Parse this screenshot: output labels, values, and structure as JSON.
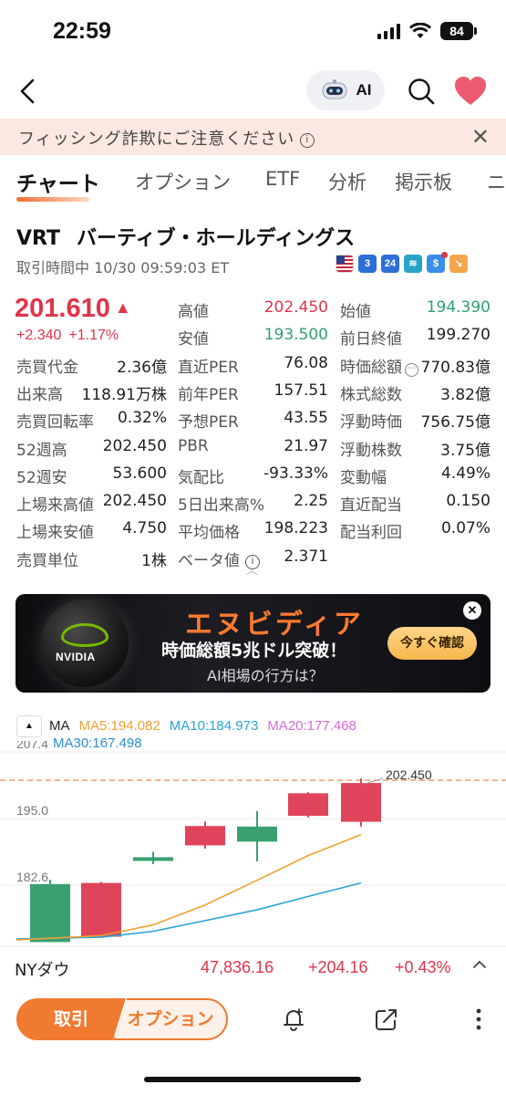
{
  "status": {
    "time": "22:59",
    "battery": "84"
  },
  "nav": {
    "ai_label": "AI"
  },
  "banner": {
    "text": "フィッシング詐欺にご注意ください"
  },
  "tabs": [
    "チャート",
    "オプション",
    "ETF",
    "分析",
    "掲示板",
    "ニ"
  ],
  "stock": {
    "ticker": "VRT",
    "name": "バーティブ・ホールディングス",
    "trade_status": "取引時間中 10/30 09:59:03 ET",
    "price": "201.610",
    "change": "+2.340",
    "change_pct": "+1.17%"
  },
  "badges": [
    {
      "icon": "us-flag-icon",
      "text": "",
      "color": "#ffffff"
    },
    {
      "icon": "level-3-icon",
      "text": "3",
      "color": "#2d6fd8"
    },
    {
      "icon": "24h-icon",
      "text": "24",
      "color": "#2d6fd8"
    },
    {
      "icon": "chart-line-icon",
      "text": "",
      "color": "#2aa3c9"
    },
    {
      "icon": "dollar-icon",
      "text": "$",
      "color": "#3b8ee8"
    },
    {
      "icon": "trend-icon",
      "text": "",
      "color": "#f3a74a"
    }
  ],
  "quote": {
    "col1": [
      {
        "label": "売買代金",
        "value": "2.36億"
      },
      {
        "label": "出来高",
        "value": "118.91万株"
      },
      {
        "label": "売買回転率",
        "value": "0.32%"
      },
      {
        "label": "52週高",
        "value": "202.450"
      },
      {
        "label": "52週安",
        "value": "53.600"
      },
      {
        "label": "上場来高値",
        "value": "202.450"
      },
      {
        "label": "上場来安値",
        "value": "4.750"
      },
      {
        "label": "売買単位",
        "value": "1株"
      }
    ],
    "col2": [
      {
        "label": "高値",
        "value": "202.450",
        "tone": "red"
      },
      {
        "label": "安値",
        "value": "193.500",
        "tone": "green"
      },
      {
        "label": "直近PER",
        "value": "76.08"
      },
      {
        "label": "前年PER",
        "value": "157.51"
      },
      {
        "label": "予想PER",
        "value": "43.55"
      },
      {
        "label": "PBR",
        "value": "21.97"
      },
      {
        "label": "気配比",
        "value": "-93.33%"
      },
      {
        "label": "5日出来高%",
        "value": "2.25"
      },
      {
        "label": "平均価格",
        "value": "198.223"
      },
      {
        "label": "ベータ値",
        "value": "2.371"
      }
    ],
    "col3": [
      {
        "label": "始値",
        "value": "194.390",
        "tone": "green"
      },
      {
        "label": "前日終値",
        "value": "199.270"
      },
      {
        "label": "時価総額",
        "value": "770.83億"
      },
      {
        "label": "株式総数",
        "value": "3.82億"
      },
      {
        "label": "浮動時価",
        "value": "756.75億"
      },
      {
        "label": "浮動株数",
        "value": "3.75億"
      },
      {
        "label": "変動幅",
        "value": "4.49%"
      },
      {
        "label": "直近配当",
        "value": "0.150"
      },
      {
        "label": "配当利回",
        "value": "0.07%"
      }
    ]
  },
  "ad": {
    "brand": "NVIDIA",
    "title": "エヌビディア",
    "line1": "時価総額5兆ドル突破！",
    "line2": "AI相場の行方は？",
    "button": "今すぐ確認"
  },
  "ma": {
    "label": "MA",
    "ma5": "MA5:194.082",
    "ma10": "MA10:184.973",
    "ma20": "MA20:177.468",
    "ma30": "MA30:167.498",
    "colors": {
      "ma5": "#f0a030",
      "ma10": "#2aa3d8",
      "ma20": "#d86ad8",
      "ma30": "#2c8fd6"
    }
  },
  "chart_data": {
    "type": "candlestick",
    "y_ticks": [
      "207.4",
      "195.0",
      "182.6"
    ],
    "high_marker": "202.450",
    "candles": [
      {
        "open": 182.8,
        "close": 172.0,
        "high": 183.6,
        "low": 172.0,
        "color": "green"
      },
      {
        "open": 173.0,
        "close": 183.0,
        "high": 183.2,
        "low": 172.8,
        "color": "red"
      },
      {
        "open": 187.1,
        "close": 187.8,
        "high": 188.8,
        "low": 186.5,
        "color": "green"
      },
      {
        "open": 190.0,
        "close": 193.6,
        "high": 194.4,
        "low": 189.4,
        "color": "red"
      },
      {
        "open": 193.5,
        "close": 190.7,
        "high": 196.4,
        "low": 187.0,
        "color": "green"
      },
      {
        "open": 195.5,
        "close": 199.7,
        "high": 199.9,
        "low": 195.2,
        "color": "red"
      },
      {
        "open": 194.39,
        "close": 201.61,
        "high": 202.45,
        "low": 193.5,
        "color": "red"
      }
    ],
    "ma5": [
      172.4,
      173.2,
      175.2,
      178.9,
      183.5,
      188.1,
      192.0
    ],
    "ma10": [
      172.6,
      172.9,
      174.0,
      176.0,
      178.0,
      180.5,
      183.0
    ],
    "ma20": [
      null,
      null,
      null,
      162.5,
      164.5,
      166.5,
      168.5
    ]
  },
  "index_bar": {
    "name": "NYダウ",
    "value": "47,836.16",
    "change": "+204.16",
    "change_pct": "+0.43%"
  },
  "bottom": {
    "trade": "取引",
    "option": "オプション"
  }
}
